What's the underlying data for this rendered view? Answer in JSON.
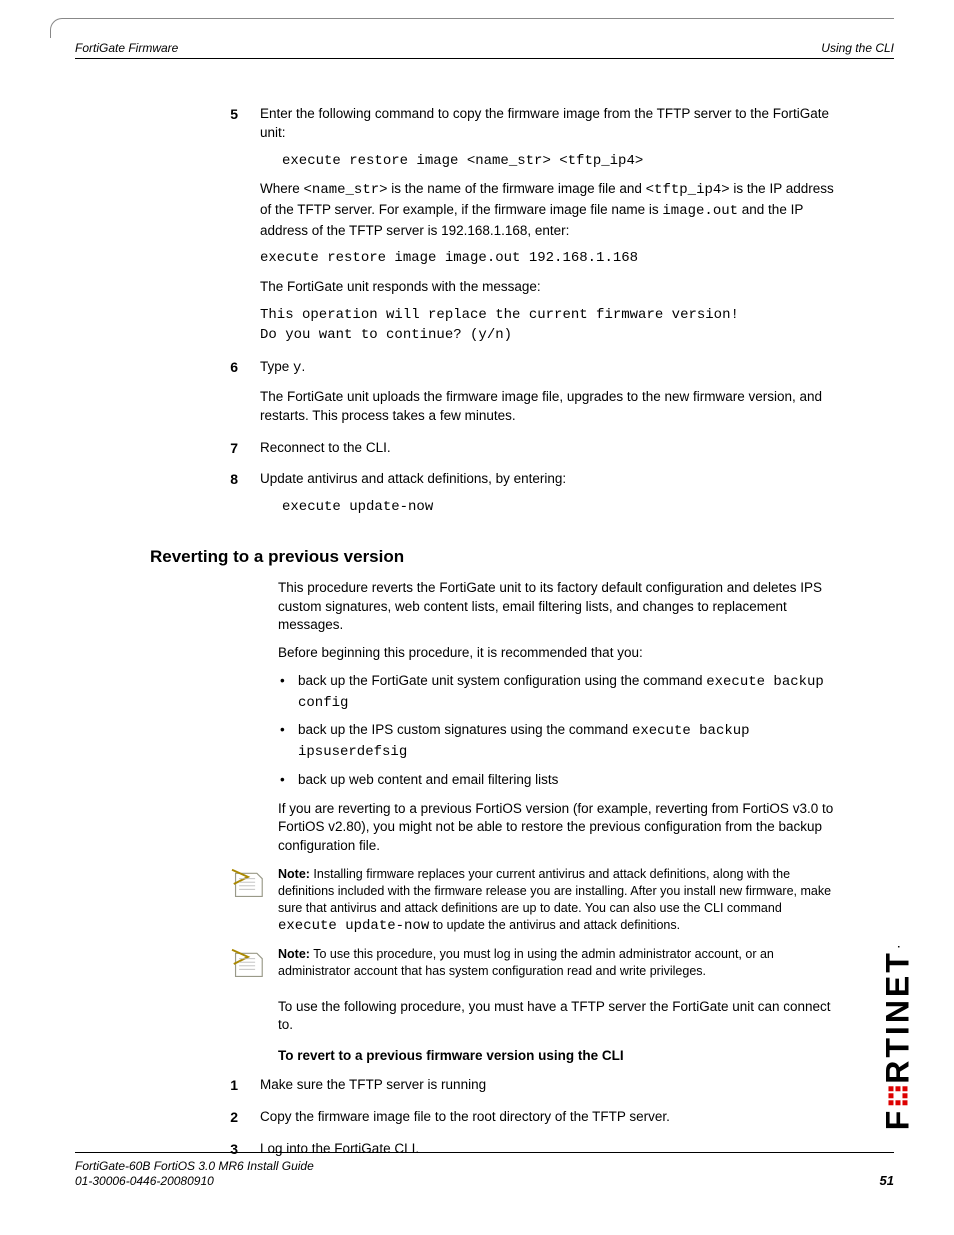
{
  "header": {
    "left": "FortiGate Firmware",
    "right": "Using the CLI"
  },
  "steps": {
    "s5": {
      "num": "5",
      "text": "Enter the following command to copy the firmware image from the TFTP server to the FortiGate unit:",
      "cmd": "execute restore image <name_str> <tftp_ip4>",
      "where_a": "Where ",
      "where_name": "<name_str>",
      "where_b": " is the name of the firmware image file and ",
      "where_tftp": "<tftp_ip4>",
      "where_c": " is the IP address of the TFTP server. For example, if the firmware image file name is ",
      "where_image": "image.out",
      "where_d": " and the IP address of the TFTP server is 192.168.1.168, enter:",
      "cmd2": "execute restore image image.out 192.168.1.168",
      "responds": "The FortiGate unit responds with the message:",
      "msg1": "This operation will replace the current firmware version!",
      "msg2": "Do you want to continue? (y/n)"
    },
    "s6": {
      "num": "6",
      "text_a": "Type ",
      "text_y": "y",
      "text_b": ".",
      "after": "The FortiGate unit uploads the firmware image file, upgrades to the new firmware version, and restarts. This process takes a few minutes."
    },
    "s7": {
      "num": "7",
      "text": "Reconnect to the CLI."
    },
    "s8": {
      "num": "8",
      "text": "Update antivirus and attack definitions, by entering:",
      "cmd": "execute update-now"
    }
  },
  "section": {
    "heading": "Reverting to a previous version",
    "p1": "This procedure reverts the FortiGate unit to its factory default configuration and deletes IPS custom signatures, web content lists, email filtering lists, and changes to replacement messages.",
    "p2": "Before beginning this procedure, it is recommended that you:",
    "bullets": {
      "b1_a": "back up the FortiGate unit system configuration using the command ",
      "b1_code": "execute backup config",
      "b2_a": "back up the IPS custom signatures using the command ",
      "b2_code": "execute backup ipsuserdefsig",
      "b3": "back up web content and email filtering lists"
    },
    "p3": "If you are reverting to a previous FortiOS version (for example, reverting from FortiOS v3.0 to FortiOS v2.80), you might not be able to restore the previous configuration from the backup configuration file.",
    "note1_label": "Note:",
    "note1_a": " Installing firmware replaces your current antivirus and attack definitions, along with the definitions included with the firmware release you are installing. After you install new firmware, make sure that antivirus and attack definitions are up to date. You can also use the CLI command ",
    "note1_code": "execute update-now",
    "note1_b": " to update the antivirus and attack definitions.",
    "note2_label": "Note:",
    "note2": " To use this procedure, you must log in using the admin administrator account, or an administrator account that has system configuration read and write privileges.",
    "p4": "To use the following procedure, you must have a TFTP server the FortiGate unit can connect to.",
    "proc_heading": "To revert to a previous firmware version using the CLI",
    "proc": {
      "n1": "1",
      "t1": "Make sure the TFTP server is running",
      "n2": "2",
      "t2": "Copy the firmware image file to the root directory of the TFTP server.",
      "n3": "3",
      "t3": "Log into the FortiGate CLI."
    }
  },
  "footer": {
    "line1": "FortiGate-60B FortiOS 3.0 MR6 Install Guide",
    "line2": "01-30006-0446-20080910",
    "page": "51"
  },
  "logo": "F   RTINET"
}
